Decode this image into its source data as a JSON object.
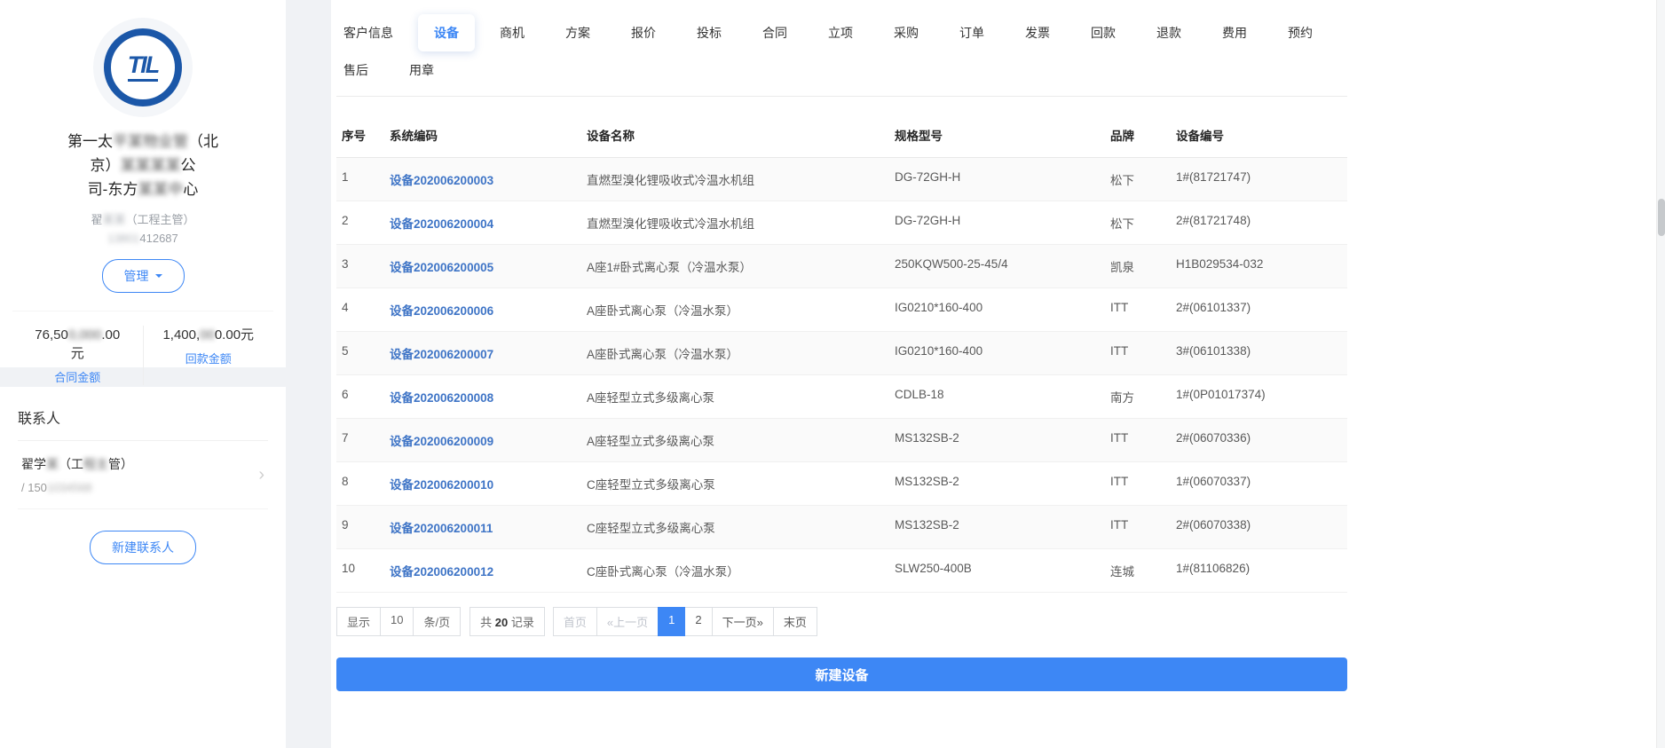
{
  "colors": {
    "accent": "#3d87f5",
    "link": "#3e74c6",
    "logo_blue": "#1b57a8",
    "page_bg": "#f0f2f5"
  },
  "sidebar": {
    "logo_text": "TIL",
    "company": {
      "l1_pre": "第一太",
      "l1_mid": "平某物业管",
      "l1_post": "（北",
      "l2_pre": "京）",
      "l2_mid": "某某某某",
      "l2_post": "公",
      "l3_pre": "司-东方",
      "l3_mid": "某某中",
      "l3_post": "心"
    },
    "owner": {
      "pre": "翟",
      "mid": "某某",
      "post": "（工程主管）"
    },
    "owner_phone": {
      "mid": "13801",
      "post": "412687"
    },
    "manage_button": "管理",
    "stats": {
      "left": {
        "value_pre": "76,50",
        "value_mid": "0,000",
        "value_post": ".00",
        "unit": "元",
        "label": "合同金额"
      },
      "right": {
        "value_pre": "1,400,",
        "value_mid": "00",
        "value_post": "0.00元",
        "label": "回款金额"
      }
    },
    "contacts": {
      "title": "联系人",
      "item": {
        "name_pre": "翟学",
        "name_mid": "某",
        "name_open": "（工",
        "name_mid2": "程主",
        "name_post": "管）",
        "phone_pre": "/ 150",
        "phone_mid": "1034568"
      },
      "new_button": "新建联系人"
    }
  },
  "tabs": {
    "row1": [
      {
        "label": "客户信息"
      },
      {
        "label": "设备",
        "active": true
      },
      {
        "label": "商机"
      },
      {
        "label": "方案"
      },
      {
        "label": "报价"
      },
      {
        "label": "投标"
      },
      {
        "label": "合同"
      },
      {
        "label": "立项"
      },
      {
        "label": "采购"
      },
      {
        "label": "订单"
      },
      {
        "label": "发票"
      },
      {
        "label": "回款"
      },
      {
        "label": "退款"
      },
      {
        "label": "费用"
      },
      {
        "label": "预约"
      }
    ],
    "row2": [
      {
        "label": "售后"
      },
      {
        "label": "用章"
      }
    ]
  },
  "table": {
    "headers": [
      "序号",
      "系统编码",
      "设备名称",
      "规格型号",
      "品牌",
      "设备编号"
    ],
    "rows": [
      {
        "no": "1",
        "code": "设备202006200003",
        "name": "直燃型溴化锂吸收式冷温水机组",
        "spec": "DG-72GH-H",
        "brand": "松下",
        "serial": "1#(81721747)"
      },
      {
        "no": "2",
        "code": "设备202006200004",
        "name": "直燃型溴化锂吸收式冷温水机组",
        "spec": "DG-72GH-H",
        "brand": "松下",
        "serial": "2#(81721748)"
      },
      {
        "no": "3",
        "code": "设备202006200005",
        "name": "A座1#卧式离心泵（冷温水泵）",
        "spec": "250KQW500-25-45/4",
        "brand": "凯泉",
        "serial": "H1B029534-032"
      },
      {
        "no": "4",
        "code": "设备202006200006",
        "name": "A座卧式离心泵（冷温水泵）",
        "spec": "IG0210*160-400",
        "brand": "ITT",
        "serial": "2#(06101337)"
      },
      {
        "no": "5",
        "code": "设备202006200007",
        "name": "A座卧式离心泵（冷温水泵）",
        "spec": "IG0210*160-400",
        "brand": "ITT",
        "serial": "3#(06101338)"
      },
      {
        "no": "6",
        "code": "设备202006200008",
        "name": "A座轻型立式多级离心泵",
        "spec": "CDLB-18",
        "brand": "南方",
        "serial": "1#(0P01017374)"
      },
      {
        "no": "7",
        "code": "设备202006200009",
        "name": "A座轻型立式多级离心泵",
        "spec": "MS132SB-2",
        "brand": "ITT",
        "serial": "2#(06070336)"
      },
      {
        "no": "8",
        "code": "设备202006200010",
        "name": "C座轻型立式多级离心泵",
        "spec": "MS132SB-2",
        "brand": "ITT",
        "serial": "1#(06070337)"
      },
      {
        "no": "9",
        "code": "设备202006200011",
        "name": "C座轻型立式多级离心泵",
        "spec": "MS132SB-2",
        "brand": "ITT",
        "serial": "2#(06070338)"
      },
      {
        "no": "10",
        "code": "设备202006200012",
        "name": "C座卧式离心泵（冷温水泵）",
        "spec": "SLW250-400B",
        "brand": "连城",
        "serial": "1#(81106826)"
      }
    ]
  },
  "pagination": {
    "show_label": "显示",
    "page_size": "10",
    "per_page": "条/页",
    "total_pre": "共",
    "total_count": "20",
    "total_post": "记录",
    "pages": [
      {
        "label": "首页",
        "state": "disabled"
      },
      {
        "label": "«上一页",
        "state": "disabled"
      },
      {
        "label": "1",
        "state": "active"
      },
      {
        "label": "2",
        "state": ""
      },
      {
        "label": "下一页»",
        "state": ""
      },
      {
        "label": "末页",
        "state": ""
      }
    ]
  },
  "footer": {
    "new_device_button": "新建设备"
  }
}
